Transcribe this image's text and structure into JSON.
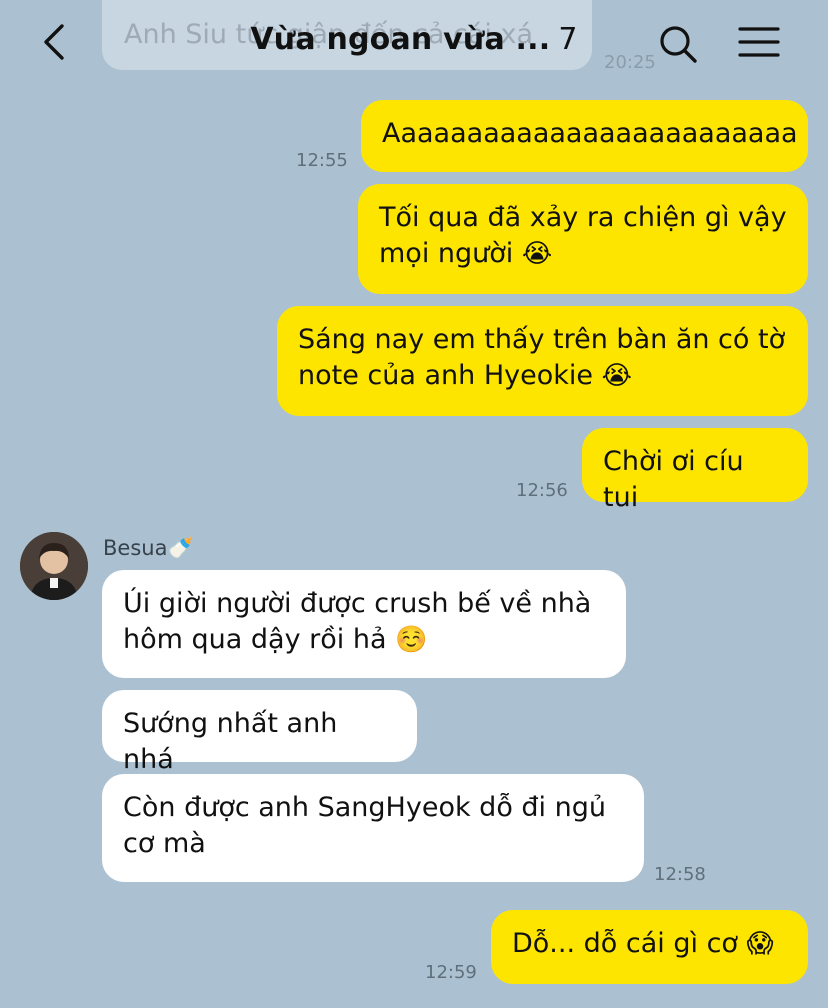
{
  "header": {
    "back_label": "Back",
    "title": "Vừa ngoan vừa ...",
    "member_count": "7",
    "peek_text": "Anh Siu tức giận đến cả cái xá",
    "peek_time": "20:25"
  },
  "messages": {
    "m1": {
      "text": "Aaaaaaaaaaaaaaaaaaaaaaaaa",
      "time": "12:55"
    },
    "m2": {
      "line1": "Tối qua đã xảy ra chiện gì vậy",
      "line2": "mọi người",
      "emoji": "😭"
    },
    "m3": {
      "line1": "Sáng nay em thấy trên bàn ăn có tờ",
      "line2": "note của anh Hyeokie",
      "emoji": "😭"
    },
    "m4": {
      "text": "Chời ơi cíu tui",
      "time": "12:56"
    },
    "sender": {
      "name": "Besua",
      "emoji": "🍼"
    },
    "m5": {
      "line1": "Úi giời người được crush bế về nhà",
      "line2": "hôm qua dậy rồi hả",
      "emoji": "☺️"
    },
    "m6": {
      "text": "Sướng nhất anh nhá"
    },
    "m7": {
      "line1": "Còn được anh SangHyeok dỗ đi ngủ",
      "line2": "cơ mà",
      "time": "12:58"
    },
    "m8": {
      "text": "Dỗ... dỗ cái gì cơ",
      "emoji": "😱",
      "time": "12:59"
    }
  },
  "colors": {
    "background": "#abc1d1",
    "my_bubble": "#fee500",
    "their_bubble": "#ffffff"
  }
}
